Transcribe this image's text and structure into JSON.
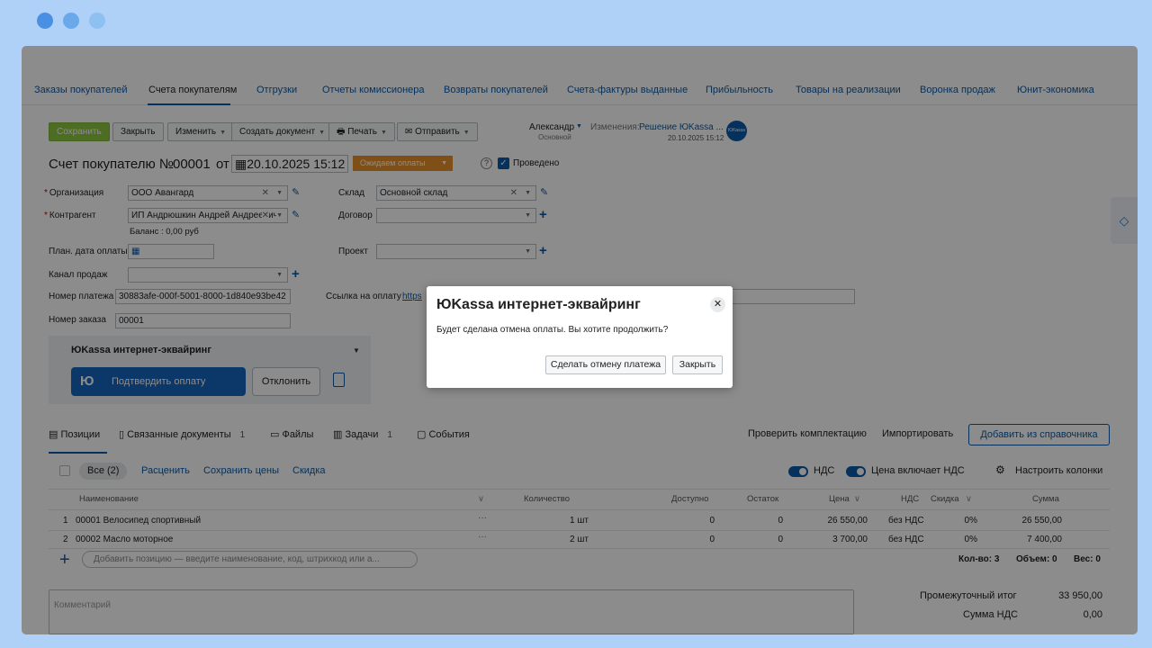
{
  "window": {
    "dot_colors": [
      "#4a90e2",
      "#6aa8ec",
      "#8fc0f2"
    ]
  },
  "nav_tabs": [
    {
      "label": "Заказы покупателей",
      "active": false
    },
    {
      "label": "Счета покупателям",
      "active": true
    },
    {
      "label": "Отгрузки",
      "active": false
    },
    {
      "label": "Отчеты комиссионера",
      "active": false
    },
    {
      "label": "Возвраты покупателей",
      "active": false
    },
    {
      "label": "Счета-фактуры выданные",
      "active": false
    },
    {
      "label": "Прибыльность",
      "active": false
    },
    {
      "label": "Товары на реализации",
      "active": false
    },
    {
      "label": "Воронка продаж",
      "active": false
    },
    {
      "label": "Юнит-экономика",
      "active": false
    }
  ],
  "toolbar": {
    "save": "Сохранить",
    "close": "Закрыть",
    "edit": "Изменить",
    "create_doc": "Создать документ",
    "print": "Печать",
    "send": "Отправить"
  },
  "user": {
    "name": "Александр",
    "role": "Основной"
  },
  "changes": {
    "label": "Изменения:",
    "value": "Решение ЮKassa ...",
    "date": "20.10.2025 15:12",
    "avatar_text": "ЮKassa"
  },
  "doc": {
    "title_prefix": "Счет покупателю №",
    "number": "00001",
    "from_label": "от",
    "date": "20.10.2025 15:12",
    "status": "Ожидаем оплаты",
    "help": "?",
    "posted_label": "Проведено"
  },
  "form": {
    "org_label": "Организация",
    "org_value": "ООО Авангард",
    "counterparty_label": "Контрагент",
    "counterparty_value": "ИП Андрюшкин Андрей Андреевич",
    "balance": "Баланс : 0,00 руб",
    "plan_date_label": "План. дата оплаты",
    "channel_label": "Канал продаж",
    "payment_no_label": "Номер платежа",
    "payment_no_value": "30883afe-000f-5001-8000-1d840e93be42",
    "order_no_label": "Номер заказа",
    "order_no_value": "00001",
    "warehouse_label": "Склад",
    "warehouse_value": "Основной склад",
    "contract_label": "Договор",
    "project_label": "Проект",
    "pay_link_label": "Ссылка на оплату",
    "pay_link_value": "https"
  },
  "yookassa_panel": {
    "title": "ЮKassa интернет-эквайринг",
    "confirm": "Подтвердить оплату",
    "reject": "Отклонить"
  },
  "pos_tabs": {
    "positions": "Позиции",
    "related": "Связанные документы",
    "related_count": "1",
    "files": "Файлы",
    "tasks": "Задачи",
    "tasks_count": "1",
    "events": "События",
    "check": "Проверить комплектацию",
    "import": "Импортировать",
    "add_from_catalog": "Добавить из справочника"
  },
  "filter_bar": {
    "all": "Все (2)",
    "recalc": "Расценить",
    "save_prices": "Сохранить цены",
    "discount": "Скидка",
    "vat": "НДС",
    "price_incl_vat": "Цена включает НДС",
    "columns": "Настроить колонки",
    "vat_on": true,
    "price_incl_vat_on": true
  },
  "table": {
    "headers": {
      "name": "Наименование",
      "qty": "Количество",
      "available": "Доступно",
      "rest": "Остаток",
      "price": "Цена",
      "vat": "НДС",
      "discount": "Скидка",
      "sum": "Сумма"
    },
    "rows": [
      {
        "n": "1",
        "name": "00001 Велосипед спортивный",
        "qty": "1 шт",
        "available": "0",
        "rest": "0",
        "price": "26 550,00",
        "vat": "без НДС",
        "discount": "0%",
        "sum": "26 550,00"
      },
      {
        "n": "2",
        "name": "00002 Масло моторное",
        "qty": "2 шт",
        "available": "0",
        "rest": "0",
        "price": "3 700,00",
        "vat": "без НДС",
        "discount": "0%",
        "sum": "7 400,00"
      }
    ],
    "add_placeholder": "Добавить позицию — введите наименование, код, штрихкод или а...",
    "totals": {
      "count": "Кол-во: 3",
      "volume": "Объем: 0",
      "weight": "Вес: 0"
    }
  },
  "comment": {
    "placeholder": "Комментарий"
  },
  "summary": {
    "subtotal_label": "Промежуточный итог",
    "subtotal_value": "33 950,00",
    "vat_label": "Сумма НДС",
    "vat_value": "0,00"
  },
  "modal": {
    "title": "ЮKassa интернет-эквайринг",
    "message": "Будет сделана отмена оплаты. Вы хотите продолжить?",
    "confirm": "Сделать отмену платежа",
    "close": "Закрыть"
  }
}
